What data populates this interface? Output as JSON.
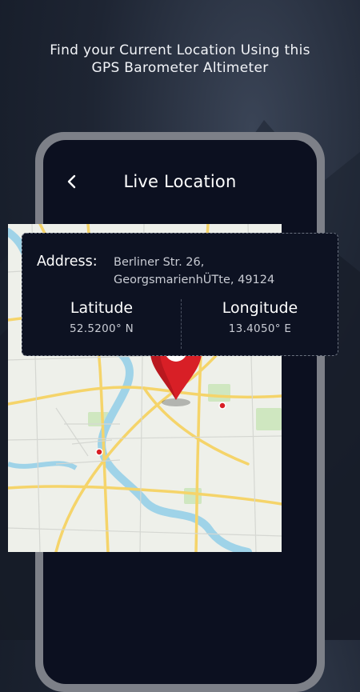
{
  "headline": {
    "line1": "Find your Current Location Using this",
    "line2": "GPS Barometer Altimeter"
  },
  "screen": {
    "title": "Live Location",
    "back_icon": "chevron-left-icon"
  },
  "location_card": {
    "address_label": "Address:",
    "address_line1": "Berliner Str. 26,",
    "address_line2": "GeorgsmarienhÜTte, 49124",
    "latitude_label": "Latitude",
    "latitude_value": "52.5200° N",
    "longitude_label": "Longitude",
    "longitude_value": "13.4050° E"
  },
  "map": {
    "pin_icon": "map-pin-icon",
    "pin_color": "#d81f26"
  },
  "colors": {
    "background": "#1a2130",
    "phone_frame": "#7d8088",
    "screen": "#0c1020",
    "map_land": "#eef0ea",
    "road_yellow": "#f5d46a",
    "river": "#9fd3e8"
  }
}
